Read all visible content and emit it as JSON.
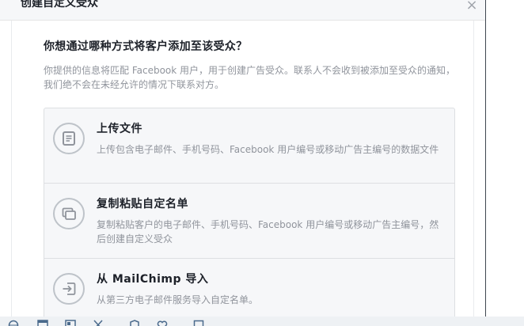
{
  "dialog": {
    "title": "创建自定义受众",
    "close_label": "×"
  },
  "main": {
    "question": "你想通过哪种方式将客户添加至该受众？",
    "description": "你提供的信息将匹配 Facebook 用户，用于创建广告受众。联系人不会收到被添加至受众的通知，我们绝不会在未经允许的情况下联系对方。"
  },
  "options": [
    {
      "title": "上传文件",
      "description": "上传包含电子邮件、手机号码、Facebook 用户编号或移动广告主编号的数据文件",
      "icon": "document-icon"
    },
    {
      "title": "复制粘贴自定名单",
      "description": "复制粘贴客户的电子邮件、手机号码、Facebook 用户编号或移动广告主编号，然后创建自定义受众",
      "icon": "copy-paste-icon"
    },
    {
      "title": "从 MailChimp 导入",
      "description": "从第三方电子邮件服务导入自定名单。",
      "icon": "import-icon"
    }
  ],
  "taskbar": {
    "icons": [
      "globe-icon",
      "window-icon",
      "window-icon",
      "scissors-icon",
      "shield-icon",
      "heart-icon",
      "monitor-icon"
    ]
  },
  "colors": {
    "title_text": "#1d2129",
    "secondary_text": "#90949c",
    "option_background": "#f6f7f9",
    "border": "#dddfe2",
    "icon_stroke": "#90949c"
  }
}
